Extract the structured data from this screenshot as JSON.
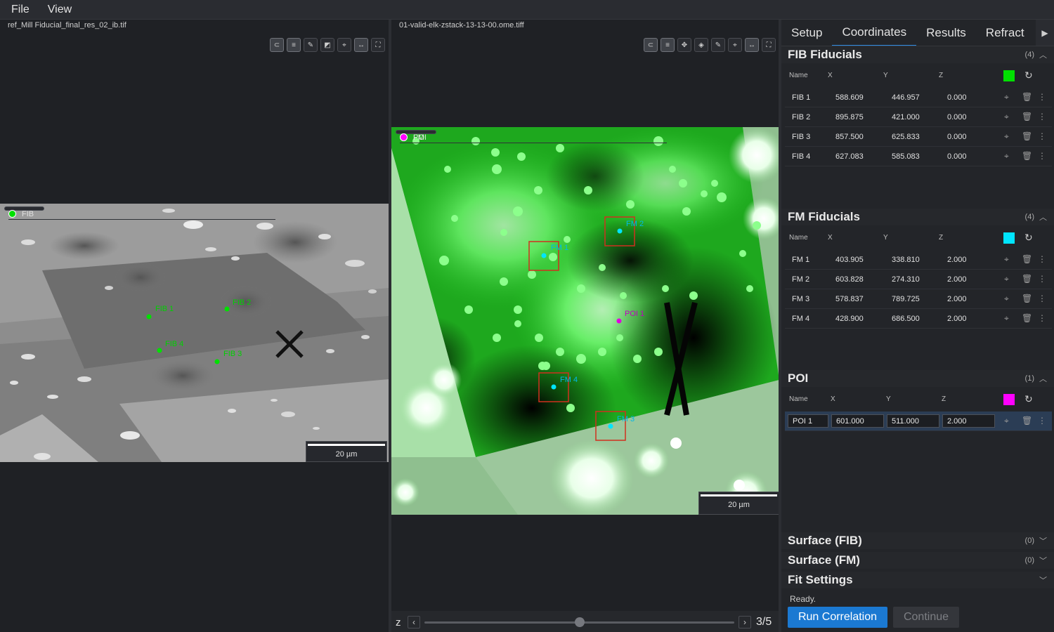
{
  "menu": {
    "file": "File",
    "view": "View"
  },
  "left_pane": {
    "title": "ref_Mill Fiducial_final_res_02_ib.tif",
    "legend": [
      {
        "label": "FIB",
        "color": "#00e000"
      }
    ],
    "scalebar": "20 µm",
    "markers": [
      {
        "label": "FIB 1"
      },
      {
        "label": "FIB 2"
      },
      {
        "label": "FIB 4"
      },
      {
        "label": "FIB 3"
      }
    ]
  },
  "mid_pane": {
    "title": "01-valid-elk-zstack-13-13-00.ome.tiff",
    "legend": [
      {
        "label": "FM",
        "color": "#00e5ff"
      },
      {
        "label": "POI",
        "color": "#ff00ff"
      }
    ],
    "scalebar": "20 µm",
    "markers": [
      {
        "label": "FM 1"
      },
      {
        "label": "FM 2"
      },
      {
        "label": "POI 1"
      },
      {
        "label": "FM 4"
      },
      {
        "label": "FM 3"
      }
    ],
    "z": {
      "label": "z",
      "value": "3/5",
      "position": 0.5
    }
  },
  "tabs": [
    "Setup",
    "Coordinates",
    "Results",
    "Refract"
  ],
  "columns": {
    "name": "Name",
    "x": "X",
    "y": "Y",
    "z": "Z"
  },
  "fib_fiducials": {
    "title": "FIB Fiducials",
    "count": "(4)",
    "color": "#00e000",
    "rows": [
      {
        "name": "FIB 1",
        "x": "588.609",
        "y": "446.957",
        "z": "0.000"
      },
      {
        "name": "FIB 2",
        "x": "895.875",
        "y": "421.000",
        "z": "0.000"
      },
      {
        "name": "FIB 3",
        "x": "857.500",
        "y": "625.833",
        "z": "0.000"
      },
      {
        "name": "FIB 4",
        "x": "627.083",
        "y": "585.083",
        "z": "0.000"
      }
    ]
  },
  "fm_fiducials": {
    "title": "FM Fiducials",
    "count": "(4)",
    "color": "#00e5ff",
    "rows": [
      {
        "name": "FM 1",
        "x": "403.905",
        "y": "338.810",
        "z": "2.000"
      },
      {
        "name": "FM 2",
        "x": "603.828",
        "y": "274.310",
        "z": "2.000"
      },
      {
        "name": "FM 3",
        "x": "578.837",
        "y": "789.725",
        "z": "2.000"
      },
      {
        "name": "FM 4",
        "x": "428.900",
        "y": "686.500",
        "z": "2.000"
      }
    ]
  },
  "poi": {
    "title": "POI",
    "count": "(1)",
    "color": "#ff00ff",
    "rows": [
      {
        "name": "POI 1",
        "x": "601.000",
        "y": "511.000",
        "z": "2.000"
      }
    ]
  },
  "surface_fib": {
    "title": "Surface (FIB)",
    "count": "(0)"
  },
  "surface_fm": {
    "title": "Surface (FM)",
    "count": "(0)"
  },
  "fit_settings": {
    "title": "Fit Settings"
  },
  "status": "Ready.",
  "buttons": {
    "run": "Run Correlation",
    "continue": "Continue"
  }
}
